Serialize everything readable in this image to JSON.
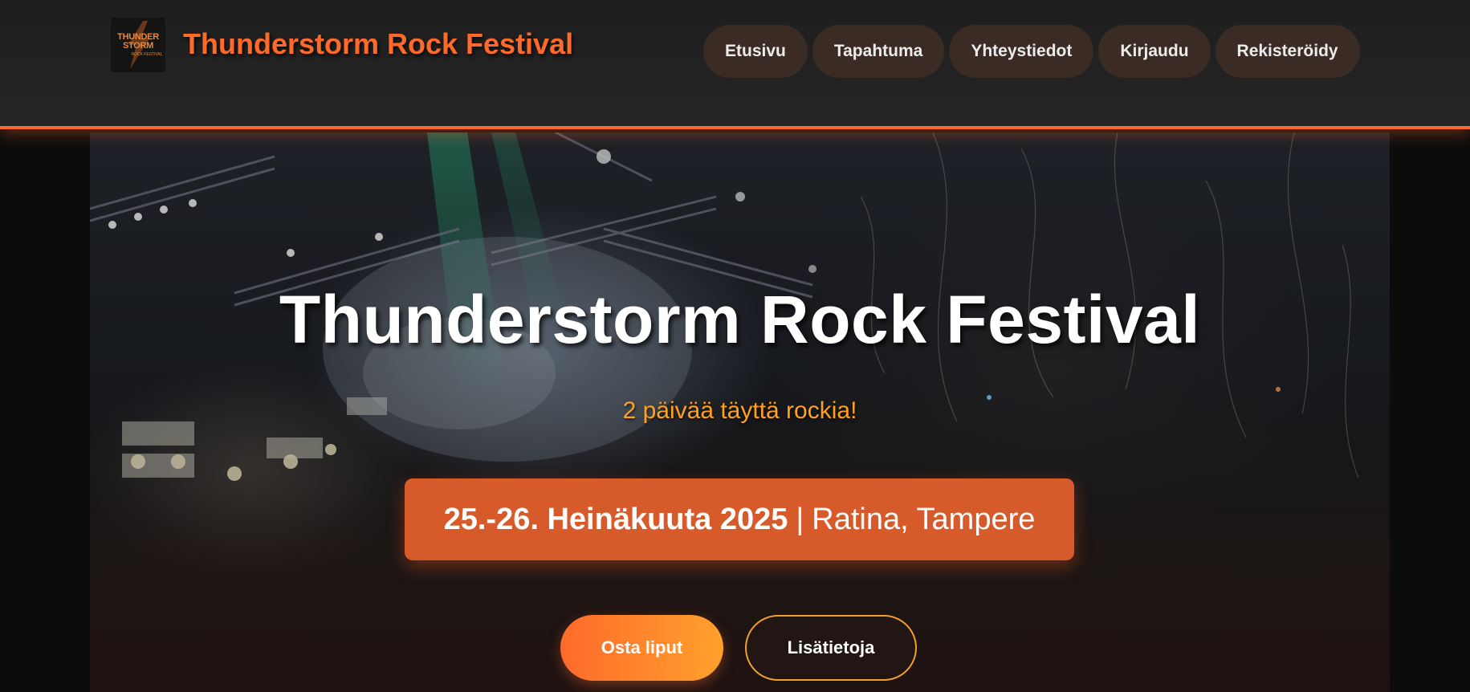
{
  "header": {
    "logo": {
      "line1": "THUNDER",
      "line2": "STORM",
      "line3": "ROCK FESTIVAL"
    },
    "title": "Thunderstorm Rock Festival",
    "nav": [
      {
        "label": "Etusivu"
      },
      {
        "label": "Tapahtuma"
      },
      {
        "label": "Yhteystiedot"
      },
      {
        "label": "Kirjaudu"
      },
      {
        "label": "Rekisteröidy"
      }
    ]
  },
  "hero": {
    "title": "Thunderstorm Rock Festival",
    "subtitle": "2 päivää täyttä rockia!",
    "dates": "25.-26. Heinäkuuta 2025",
    "separator": "|",
    "location": "Ratina, Tampere",
    "buttons": {
      "primary": "Osta liput",
      "secondary": "Lisätietoja"
    }
  },
  "colors": {
    "accent": "#ff6a2b",
    "accent_light": "#ffa11c",
    "header_bg": "#222222",
    "nav_pill_bg": "#3a2b25",
    "date_box_bg": "#ec622d"
  },
  "icons": {
    "logo": "lightning-bolt-icon"
  }
}
